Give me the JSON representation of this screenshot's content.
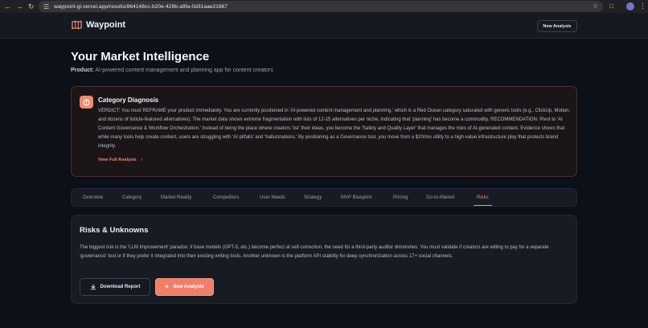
{
  "browser": {
    "url": "waypoint-gi.vercel.app/results/864148cc-b20e-429b-a9fa-0d31aae21867"
  },
  "header": {
    "brand": "Waypoint",
    "new_analysis_label": "New Analysis"
  },
  "page": {
    "title": "Your Market Intelligence",
    "product_label": "Product:",
    "product_value": "AI-powered content management and planning app for content creators"
  },
  "diagnosis": {
    "title": "Category Diagnosis",
    "body": "VERDICT: You must REFRAME your product immediately. You are currently positioned in 'AI-powered content management and planning,' which is a Red Ocean category saturated with generic tools (e.g., ClickUp, Motion, and dozens of listicle-featured alternatives). The market data shows extreme fragmentation with lists of 12-15 alternatives per niche, indicating that 'planning' has become a commodity. RECOMMENDATION: Pivot to 'AI Content Governance & Workflow Orchestration.' Instead of being the place where creators 'list' their ideas, you become the 'Safety and Quality Layer' that manages the risks of AI-generated content. Evidence shows that while many tools help create content, users are struggling with 'AI pitfalls' and 'hallucinations.' By positioning as a Governance tool, you move from a $20/mo utility to a high-value infrastructure play that protects brand integrity.",
    "link_label": "View Full Analysis",
    "accent_color": "#f08a70"
  },
  "tabs": [
    {
      "label": "Overview"
    },
    {
      "label": "Category"
    },
    {
      "label": "Market Reality"
    },
    {
      "label": "Competitors"
    },
    {
      "label": "User Needs"
    },
    {
      "label": "Strategy"
    },
    {
      "label": "MVP Blueprint"
    },
    {
      "label": "Pricing"
    },
    {
      "label": "Go-to-Market"
    },
    {
      "label": "Risks",
      "active": true
    }
  ],
  "risks": {
    "title": "Risks & Unknowns",
    "body": "The biggest risk is the 'LLM Improvement' paradox: if base models (GPT-5, etc.) become perfect at self-correction, the need for a third-party auditor diminishes. You must validate if creators are willing to pay for a separate 'governance' tool or if they prefer it integrated into their existing writing tools. Another unknown is the platform API stability for deep synchronization across 17+ social channels.",
    "download_label": "Download Report",
    "new_analysis_label": "New Analysis"
  }
}
